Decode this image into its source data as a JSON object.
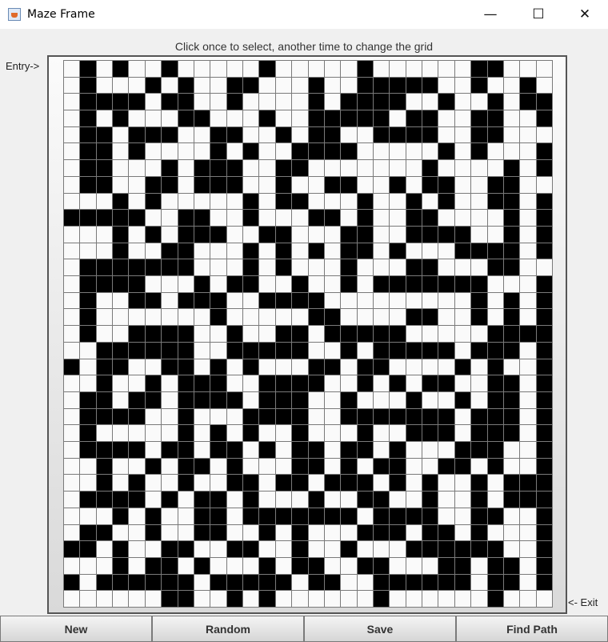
{
  "window": {
    "title": "Maze Frame",
    "minimize_glyph": "—",
    "maximize_glyph": "☐",
    "close_glyph": "✕"
  },
  "maze": {
    "instruction": "Click once to select, another time to change the grid",
    "entry_label": "Entry->",
    "exit_label": "<- Exit",
    "rows": 33,
    "cols": 30,
    "wall_color": "#000000",
    "open_color": "#fafafa",
    "grid": [
      "010100100000100000100000011000",
      "010001010011000100111110010010",
      "011110110010000101111001001011",
      "010100011000100111110110011001",
      "011011100110010110011110011000",
      "011010000101001111000001010001",
      "011000101110011000000010000101",
      "011001101110010011001011001100",
      "000101000001011000100101001101",
      "111110011001000110100110000101",
      "000101011100110001100111100101",
      "000100110001010101101000111101",
      "011111110001010001000110001100",
      "011110001011001001011111110001",
      "010011011100111100000000010101",
      "010000000100000110000110010101",
      "010011110010011011111000001111",
      "001111110011111001011111011101",
      "101100110101000110110000101001",
      "001001011100111100101011001101",
      "011011011110111001000100101101",
      "011110010001111001111111011101",
      "010000010101001000100111011101",
      "011110110110101101101000111001",
      "001001011010001101011001101001",
      "001010010011011011101010010111",
      "011110101101000100110010010111",
      "000101001101111111011110011001",
      "011001001100101000111011010001",
      "110100110011001001000111111001",
      "000101101000101100110001101101",
      "101111110111110110011111101101",
      "000000110010100000010000001000"
    ]
  },
  "buttons": {
    "new_label": "New",
    "random_label": "Random",
    "save_label": "Save",
    "find_path_label": "Find Path"
  }
}
